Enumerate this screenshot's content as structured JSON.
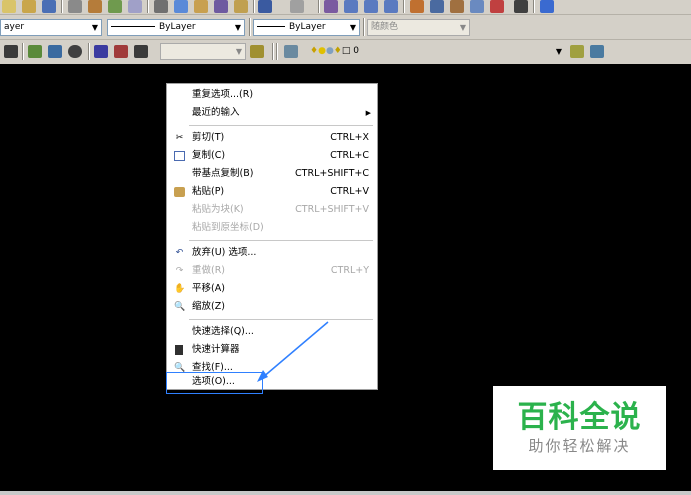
{
  "toolbar": {
    "layer_combo": "ayer",
    "linetype_combo": "ByLayer",
    "lineweight_combo": "ByLayer",
    "color_combo": "随颜色",
    "layer_name": "0"
  },
  "menu": {
    "repeat": {
      "label": "重复选项...(R)"
    },
    "recent": {
      "label": "最近的输入"
    },
    "cut": {
      "label": "剪切(T)",
      "shortcut": "CTRL+X"
    },
    "copy": {
      "label": "复制(C)",
      "shortcut": "CTRL+C"
    },
    "copy_base": {
      "label": "带基点复制(B)",
      "shortcut": "CTRL+SHIFT+C"
    },
    "paste": {
      "label": "粘贴(P)",
      "shortcut": "CTRL+V"
    },
    "paste_block": {
      "label": "粘贴为块(K)",
      "shortcut": "CTRL+SHIFT+V"
    },
    "paste_orig": {
      "label": "粘贴到原坐标(D)"
    },
    "undo": {
      "label": "放弃(U) 选项..."
    },
    "redo": {
      "label": "重做(R)",
      "shortcut": "CTRL+Y"
    },
    "pan": {
      "label": "平移(A)"
    },
    "zoom": {
      "label": "缩放(Z)"
    },
    "quick_select": {
      "label": "快速选择(Q)..."
    },
    "quick_calc": {
      "label": "快速计算器"
    },
    "find": {
      "label": "查找(F)..."
    },
    "options": {
      "label": "选项(O)..."
    }
  },
  "watermark": {
    "title": "百科全说",
    "subtitle": "助你轻松解决"
  },
  "colors": {
    "highlight": "#2f80ff",
    "watermark_green": "#2bb24c"
  }
}
